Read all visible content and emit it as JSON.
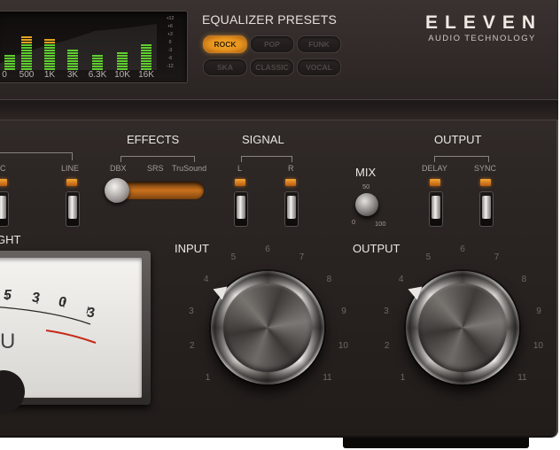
{
  "colors": {
    "accent_orange": "#f0a030",
    "panel": "#2c2624",
    "label": "#ece7e3"
  },
  "spectrum": {
    "bands": [
      {
        "label": "0",
        "level": 0.35
      },
      {
        "label": "500",
        "level": 0.72
      },
      {
        "label": "1K",
        "level": 0.64
      },
      {
        "label": "3K",
        "level": 0.45
      },
      {
        "label": "6.3K",
        "level": 0.32
      },
      {
        "label": "10K",
        "level": 0.4
      },
      {
        "label": "16K",
        "level": 0.55
      }
    ],
    "db_scale": [
      "+12",
      "+6",
      "+3",
      "0",
      "-3",
      "-6",
      "-12"
    ]
  },
  "equalizer": {
    "title": "EQUALIZER PRESETS",
    "presets": [
      {
        "label": "ROCK",
        "active": true
      },
      {
        "label": "POP",
        "active": false
      },
      {
        "label": "FUNK",
        "active": false
      },
      {
        "label": "SKA",
        "active": false
      },
      {
        "label": "CLASSIC",
        "active": false
      },
      {
        "label": "VOCAL",
        "active": false
      }
    ]
  },
  "brand": {
    "name": "ELEVEN",
    "subtitle": "AUDIO TECHNOLOGY"
  },
  "inputs": {
    "partial_label": "C",
    "line_label": "LINE"
  },
  "effects": {
    "title": "EFFECTS",
    "options": [
      "DBX",
      "SRS",
      "TruSound"
    ]
  },
  "signal": {
    "title": "SIGNAL",
    "left": "L",
    "right": "R"
  },
  "mix": {
    "title": "MIX",
    "min": "0",
    "mid": "50",
    "max": "100"
  },
  "output_section": {
    "title": "OUTPUT",
    "delay": "DELAY",
    "sync": "SYNC"
  },
  "light_label": "GHT",
  "vu": {
    "scale": [
      "5",
      "3",
      "0",
      "3"
    ],
    "unit": "U"
  },
  "knobs": {
    "input": {
      "label": "INPUT",
      "scale": [
        "1",
        "2",
        "3",
        "4",
        "5",
        "6",
        "7",
        "8",
        "9",
        "10",
        "11"
      ]
    },
    "output": {
      "label": "OUTPUT",
      "scale": [
        "1",
        "2",
        "3",
        "4",
        "5",
        "6",
        "7",
        "8",
        "9",
        "10",
        "11"
      ]
    }
  }
}
